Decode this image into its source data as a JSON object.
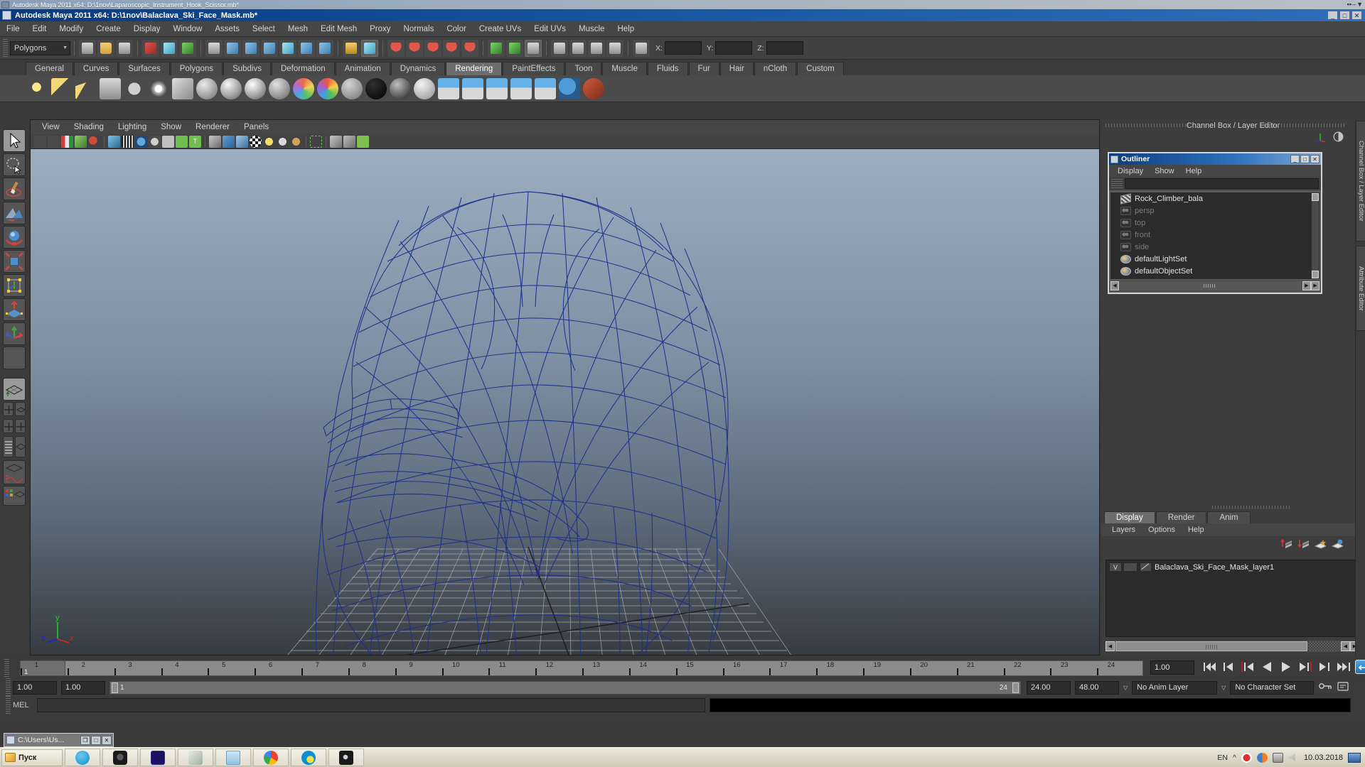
{
  "outer_window": {
    "title": "Autodesk Maya 2011 x64: D:\\1nov\\Laparoscopic_Instrument_Hook_Scissor.mb*",
    "buttons": [
      "▫",
      "–",
      "✕"
    ]
  },
  "maya_window": {
    "title": "Autodesk Maya 2011 x64: D:\\1nov\\Balaclava_Ski_Face_Mask.mb*",
    "minimize": "_",
    "maximize": "□",
    "close": "✕"
  },
  "menubar": {
    "items": [
      "File",
      "Edit",
      "Modify",
      "Create",
      "Display",
      "Window",
      "Assets",
      "Select",
      "Mesh",
      "Edit Mesh",
      "Proxy",
      "Normals",
      "Color",
      "Create UVs",
      "Edit UVs",
      "Muscle",
      "Help"
    ]
  },
  "status_line": {
    "selection_mode": "Polygons",
    "dropdown_arrow": "▼",
    "coord_labels": [
      "X:",
      "Y:",
      "Z:"
    ],
    "coord_values": [
      "",
      "",
      ""
    ]
  },
  "shelf": {
    "tabs": [
      "General",
      "Curves",
      "Surfaces",
      "Polygons",
      "Subdivs",
      "Deformation",
      "Animation",
      "Dynamics",
      "Rendering",
      "PaintEffects",
      "Toon",
      "Muscle",
      "Fluids",
      "Fur",
      "Hair",
      "nCloth",
      "Custom"
    ],
    "active_tab": "Rendering"
  },
  "viewport": {
    "menu": [
      "View",
      "Shading",
      "Lighting",
      "Show",
      "Renderer",
      "Panels"
    ],
    "axis_labels": {
      "y": "y",
      "x": "x",
      "z": "z"
    },
    "axis_colors": {
      "y": "#19d319",
      "x": "#e02020",
      "z": "#2020e0"
    },
    "model_name": "Balaclava Ski Face Mask wireframe",
    "wireframe_color": "#1c2f8c",
    "grid_color": "#b9b9b9",
    "bg_top": "#9cadc0",
    "bg_bottom": "#373c42"
  },
  "channel_box": {
    "header": "Channel Box / Layer Editor"
  },
  "outliner": {
    "title": "Outliner",
    "min_btn": "_",
    "max_btn": "□",
    "close_btn": "✕",
    "menu": [
      "Display",
      "Show",
      "Help"
    ],
    "search_value": "",
    "items": [
      {
        "label": "Rock_Climber_bala",
        "icon": "mesh-icon",
        "dim": false
      },
      {
        "label": "persp",
        "icon": "camera-icon",
        "dim": true
      },
      {
        "label": "top",
        "icon": "camera-icon",
        "dim": true
      },
      {
        "label": "front",
        "icon": "camera-icon",
        "dim": true
      },
      {
        "label": "side",
        "icon": "camera-icon",
        "dim": true
      },
      {
        "label": "defaultLightSet",
        "icon": "set-icon",
        "dim": false
      },
      {
        "label": "defaultObjectSet",
        "icon": "set-icon",
        "dim": false
      }
    ]
  },
  "layer_editor": {
    "tabs": [
      "Display",
      "Render",
      "Anim"
    ],
    "active_tab": "Display",
    "menu": [
      "Layers",
      "Options",
      "Help"
    ],
    "layers": [
      {
        "visibility": "V",
        "playback": "",
        "name": "Balaclava_Ski_Face_Mask_layer1"
      }
    ]
  },
  "right_strip": {
    "tabs": [
      "Channel Box / Layer Editor",
      "Attribute Editor"
    ]
  },
  "timeline": {
    "frames": [
      1,
      2,
      3,
      4,
      5,
      6,
      7,
      8,
      9,
      10,
      11,
      12,
      13,
      14,
      15,
      16,
      17,
      18,
      19,
      20,
      21,
      22,
      23,
      24
    ],
    "current_frame": "1",
    "current_frame_field": "1.00",
    "playback_buttons": [
      "go-to-start",
      "step-back-key",
      "step-back-frame",
      "play-backwards",
      "play-forwards",
      "step-forward-frame",
      "step-forward-key",
      "go-to-end",
      "sound-toggle"
    ]
  },
  "range_slider": {
    "anim_start": "1.00",
    "anim_end": "1.00",
    "range_start_label": "1",
    "range_end_label": "24",
    "playback_end": "24.00",
    "anim_end_field": "48.00",
    "anim_layer": "No Anim Layer",
    "character_set": "No Character Set",
    "dropdown_arrow": "▽"
  },
  "command_line": {
    "language": "MEL",
    "input_value": "",
    "output_value": ""
  },
  "mini_window": {
    "title": "C:\\Users\\Us...",
    "restore": "❐",
    "maximize": "□",
    "close": "✕"
  },
  "taskbar": {
    "start_label": "Пуск",
    "apps": [
      "skype-icon",
      "camera-app-icon",
      "photoshop-icon",
      "wireframe-app-icon",
      "folder-icon",
      "chrome-icon",
      "skype2-icon",
      "maya-icon"
    ],
    "tray": {
      "language": "EN",
      "caret": "^",
      "icons": [
        "antivirus-icon",
        "firefox-icon",
        "network-icon",
        "volume-icon"
      ],
      "date": "10.03.2018"
    }
  }
}
